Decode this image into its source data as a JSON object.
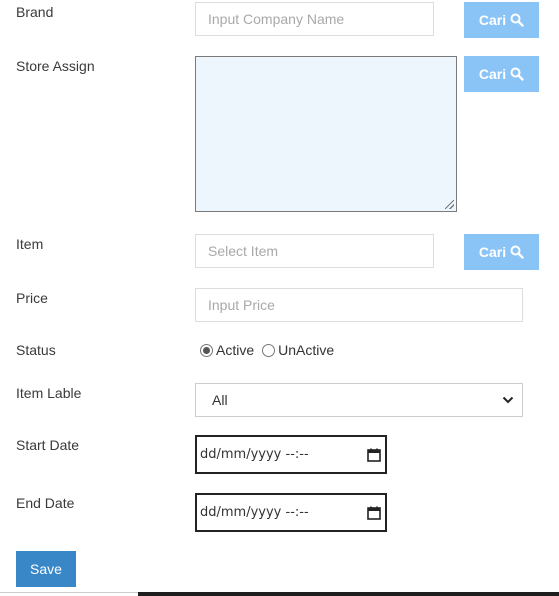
{
  "form": {
    "brand": {
      "label": "Brand",
      "placeholder": "Input Company Name",
      "button": "Cari"
    },
    "store_assign": {
      "label": "Store Assign",
      "value": "",
      "button": "Cari"
    },
    "item": {
      "label": "Item",
      "placeholder": "Select Item",
      "button": "Cari"
    },
    "price": {
      "label": "Price",
      "placeholder": "Input Price"
    },
    "status": {
      "label": "Status",
      "options": [
        "Active",
        "UnActive"
      ],
      "selected": "Active"
    },
    "item_lable": {
      "label": "Item Lable",
      "selected": "All"
    },
    "start_date": {
      "label": "Start Date",
      "placeholder": "dd/mm/yyyy --:--"
    },
    "end_date": {
      "label": "End Date",
      "placeholder": "dd/mm/yyyy --:--"
    },
    "save_label": "Save"
  },
  "icons": {
    "cari": "search-icon",
    "dropdown": "chevron-down-icon",
    "calendar": "calendar-icon"
  },
  "colors": {
    "cari_button": "#8ac3f5",
    "save_button": "#3a87c8",
    "textarea_bg": "#edf5fd"
  }
}
